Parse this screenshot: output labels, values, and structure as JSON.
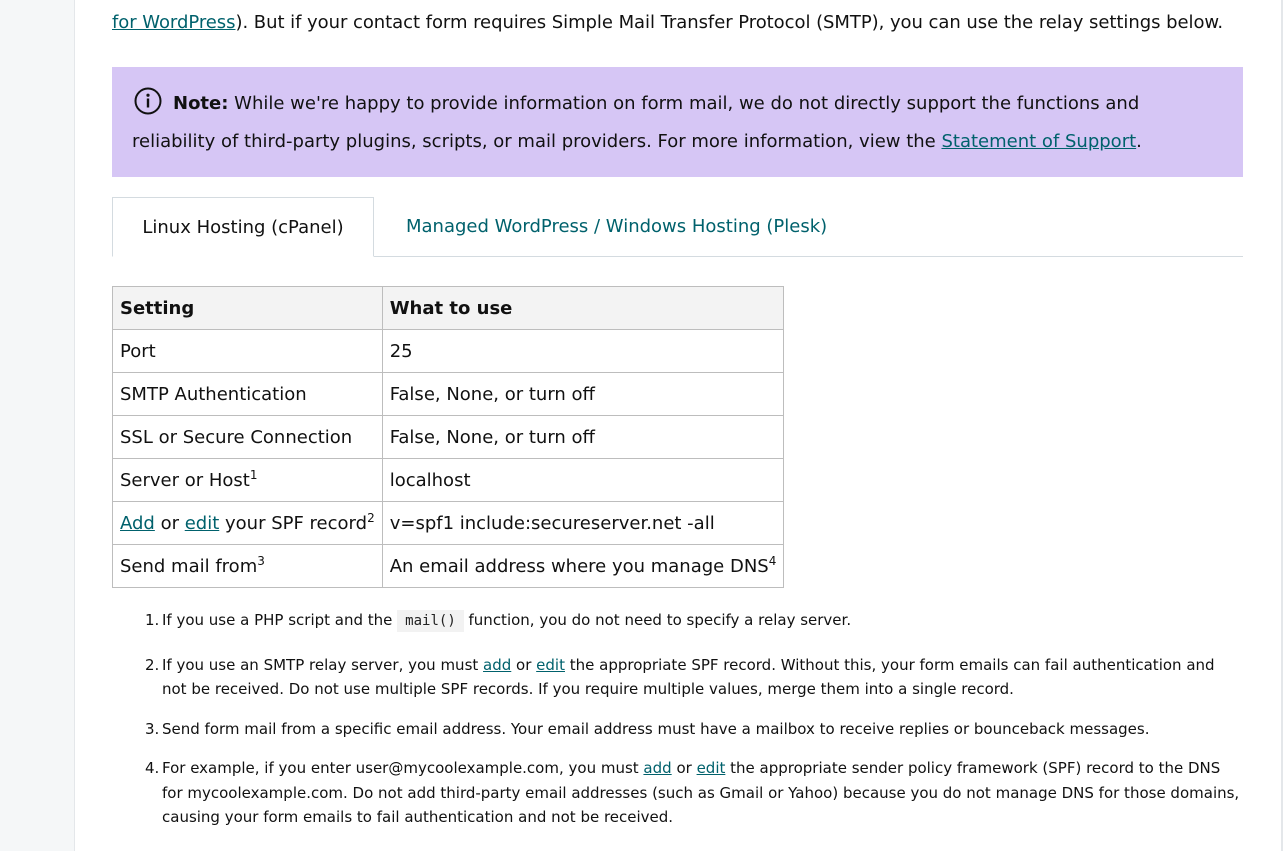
{
  "intro": {
    "link_start": "for WordPress",
    "text": "). But if your contact form requires Simple Mail Transfer Protocol (SMTP), you can use the relay settings below."
  },
  "note": {
    "label": "Note:",
    "text": " While we're happy to provide information on form mail, we do not directly support the functions and reliability of third-party plugins, scripts, or mail providers. For more information, view the ",
    "link": "Statement of Support",
    "end": "."
  },
  "tabs": [
    {
      "label": "Linux Hosting (cPanel)",
      "active": true
    },
    {
      "label": "Managed WordPress / Windows Hosting (Plesk)",
      "active": false
    }
  ],
  "table": {
    "headers": [
      "Setting",
      "What to use"
    ],
    "rows": [
      {
        "setting": "Port",
        "value": "25"
      },
      {
        "setting": "SMTP Authentication",
        "value": "False, None, or turn off"
      },
      {
        "setting": "SSL or Secure Connection",
        "value": "False, None, or turn off"
      },
      {
        "setting": "Server or Host",
        "sup": "1",
        "value": "localhost"
      },
      {
        "setting_link1": "Add",
        "setting_mid": " or ",
        "setting_link2": "edit",
        "setting_end": " your SPF record",
        "sup": "2",
        "value": "v=spf1 include:secureserver.net -all"
      },
      {
        "setting": "Send mail from",
        "sup": "3",
        "value": "An email address where you manage DNS",
        "value_sup": "4"
      }
    ]
  },
  "footnotes": [
    {
      "num": "1.",
      "a": "If you use a PHP script and the ",
      "code": "mail()",
      "b": " function, you do not need to specify a relay server."
    },
    {
      "num": "2.",
      "a": "If you use an SMTP relay server, you must ",
      "link1": "add",
      "mid": " or ",
      "link2": "edit",
      "b": " the appropriate SPF record. Without this, your form emails can fail authentication and not be received. Do not use multiple SPF records. If you require multiple values, merge them into a single record."
    },
    {
      "num": "3.",
      "a": "Send form mail from a specific email address. Your email address must have a mailbox to receive replies or bounceback messages."
    },
    {
      "num": "4.",
      "a": "For example, if you enter user@mycoolexample.com, you must ",
      "link1": "add",
      "mid": " or ",
      "link2": "edit",
      "b": " the appropriate sender policy framework (SPF) record to the DNS for mycoolexample.com. Do not add third-party email addresses (such as Gmail or Yahoo) because you do not manage DNS for those domains, causing your form emails to fail authentication and not be received."
    }
  ],
  "colors": {
    "link": "#00616c",
    "note_bg": "#d6c6f5",
    "table_header_bg": "#f3f3f3",
    "border": "#bdbdbd"
  }
}
